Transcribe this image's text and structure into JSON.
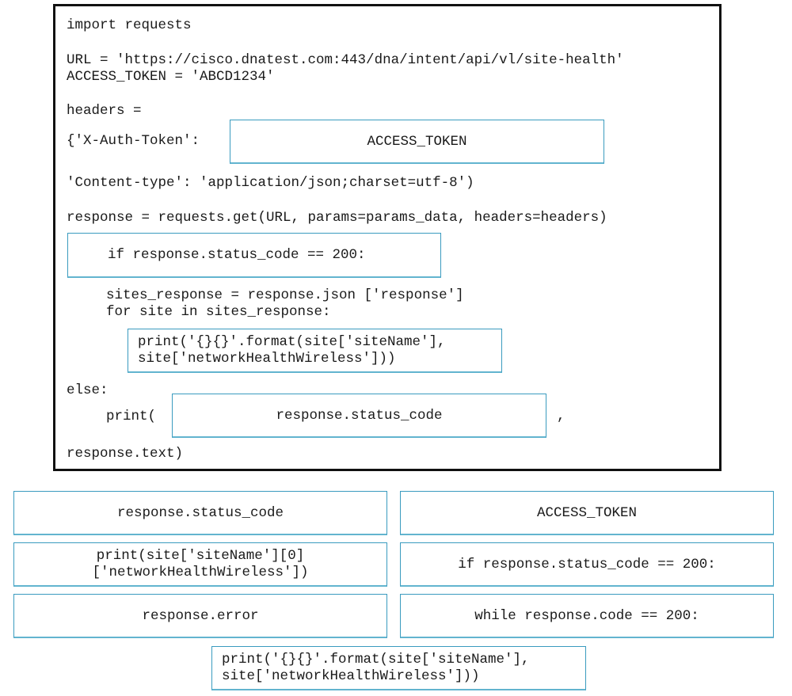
{
  "code": {
    "line_import": "import requests",
    "line_url": "URL = 'https://cisco.dnatest.com:443/dna/intent/api/vl/site-health'",
    "line_token": "ACCESS_TOKEN = 'ABCD1234'",
    "line_headers": "headers =",
    "line_auth": "{'X-Auth-Token':",
    "line_content_type": "'Content-type': 'application/json;charset=utf-8')",
    "line_get": "response = requests.get(URL, params=params_data, headers=headers)",
    "line_sites_response": "sites_response = response.json ['response']",
    "line_for": "for site in sites_response:",
    "line_else": "else:",
    "line_print_open": "print(",
    "line_comma": ",",
    "line_text": "response.text)"
  },
  "slots": {
    "slot_1": "ACCESS_TOKEN",
    "slot_2": "if response.status_code == 200:",
    "slot_3_line1": "print('{}{}'.format(site['siteName'],",
    "slot_3_line2": "site['networkHealthWireless']))",
    "slot_4": "response.status_code"
  },
  "options": [
    {
      "id": "opt-status-code",
      "label": "response.status_code"
    },
    {
      "id": "opt-access-token",
      "label": "ACCESS_TOKEN"
    },
    {
      "id": "opt-print-index",
      "line1": "print(site['siteName'][0]",
      "line2": "['networkHealthWireless'])"
    },
    {
      "id": "opt-if-status",
      "label": "if response.status_code == 200:"
    },
    {
      "id": "opt-response-error",
      "label": "response.error"
    },
    {
      "id": "opt-while-code",
      "label": "while response.code == 200:"
    },
    {
      "id": "opt-print-format",
      "line1": "print('{}{}'.format(site['siteName'],",
      "line2": "site['networkHealthWireless']))"
    }
  ],
  "colors": {
    "slot_border": "#3a9bbf",
    "panel_border": "#111111"
  }
}
